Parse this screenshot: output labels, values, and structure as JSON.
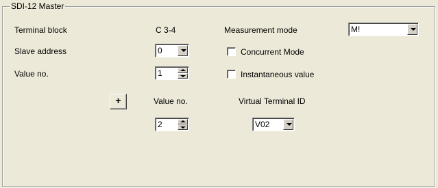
{
  "group": {
    "title": "SDI-12 Master"
  },
  "terminal_block": {
    "label": "Terminal block",
    "value": "C 3-4"
  },
  "measurement_mode": {
    "label": "Measurement mode",
    "value": "M!"
  },
  "slave_address": {
    "label": "Slave address",
    "value": "0"
  },
  "concurrent_mode": {
    "label": "Concurrent Mode",
    "checked": false
  },
  "value_no_top": {
    "label": "Value no.",
    "value": "1"
  },
  "instantaneous_value": {
    "label": "Instantaneous value",
    "checked": false
  },
  "add": {
    "label": "+"
  },
  "mapping": {
    "value_no_header": "Value no.",
    "virtual_terminal_header": "Virtual Terminal ID",
    "value_no": "2",
    "virtual_terminal_id": "V02"
  },
  "icons": [
    "chevron-down-icon",
    "spin-up-icon",
    "spin-down-icon",
    "plus-icon"
  ]
}
